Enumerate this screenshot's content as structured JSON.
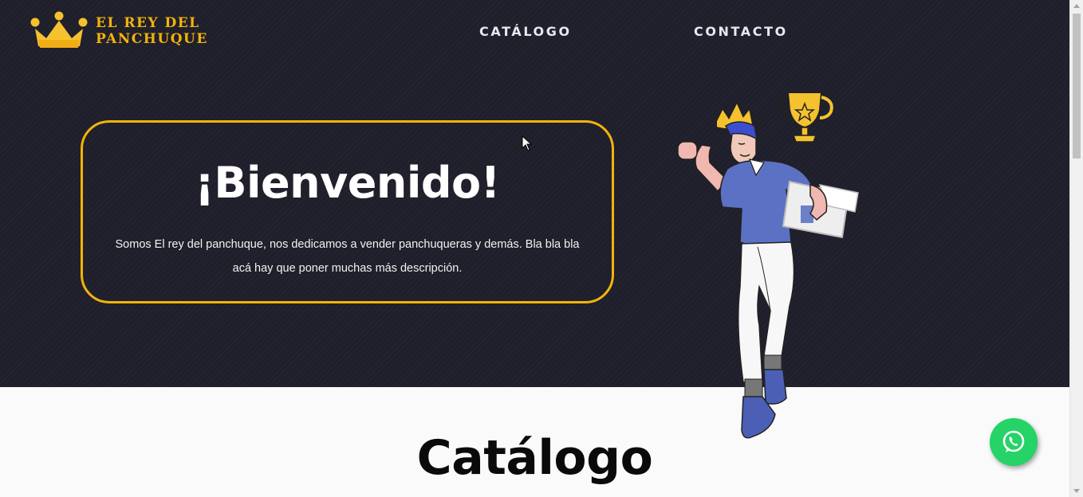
{
  "brand": {
    "name": "EL REY DEL PANCHUQUE",
    "line1": "EL REY DEL",
    "line2": "PANCHUQUE",
    "accent_color": "#f2b40a",
    "logo_icon": "crown-icon"
  },
  "nav": {
    "items": [
      {
        "label": "CATÁLOGO"
      },
      {
        "label": "CONTACTO"
      }
    ]
  },
  "hero": {
    "title": "¡Bienvenido!",
    "description": "Somos El rey del panchuque, nos dedicamos a vender panchuqueras y demás. Bla bla bla acá hay que poner muchas más descripción.",
    "background_color": "#1f1e2b",
    "illustration": "king-jumping-with-trophy-illustration"
  },
  "catalog": {
    "title": "Catálogo"
  },
  "whatsapp": {
    "icon": "whatsapp-icon",
    "color": "#25d366"
  }
}
